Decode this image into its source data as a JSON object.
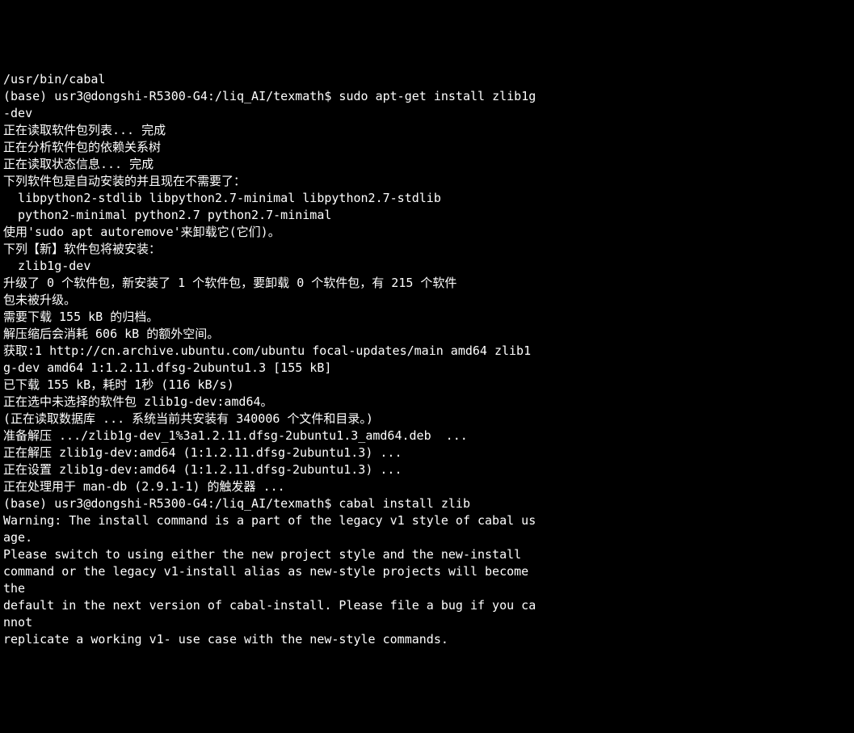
{
  "terminal": {
    "top_partial": "/usr/bin/cabal",
    "prompt1_prefix": "(base) usr3@dongshi-R5300-G4:/liq_AI/texmath$ ",
    "command1": "sudo apt-get install zlib1g",
    "command1_cont": "-dev",
    "output_lines": [
      "正在读取软件包列表... 完成",
      "正在分析软件包的依赖关系树",
      "正在读取状态信息... 完成",
      "下列软件包是自动安装的并且现在不需要了：",
      "  libpython2-stdlib libpython2.7-minimal libpython2.7-stdlib",
      "  python2-minimal python2.7 python2.7-minimal",
      "使用'sudo apt autoremove'来卸载它(它们)。",
      "下列【新】软件包将被安装：",
      "  zlib1g-dev",
      "升级了 0 个软件包，新安装了 1 个软件包，要卸载 0 个软件包，有 215 个软件",
      "包未被升级。",
      "需要下载 155 kB 的归档。",
      "解压缩后会消耗 606 kB 的额外空间。",
      "获取:1 http://cn.archive.ubuntu.com/ubuntu focal-updates/main amd64 zlib1",
      "g-dev amd64 1:1.2.11.dfsg-2ubuntu1.3 [155 kB]",
      "已下载 155 kB，耗时 1秒 (116 kB/s)",
      "正在选中未选择的软件包 zlib1g-dev:amd64。",
      "(正在读取数据库 ... 系统当前共安装有 340006 个文件和目录。)",
      "准备解压 .../zlib1g-dev_1%3a1.2.11.dfsg-2ubuntu1.3_amd64.deb  ...",
      "正在解压 zlib1g-dev:amd64 (1:1.2.11.dfsg-2ubuntu1.3) ...",
      "正在设置 zlib1g-dev:amd64 (1:1.2.11.dfsg-2ubuntu1.3) ...",
      "正在处理用于 man-db (2.9.1-1) 的触发器 ..."
    ],
    "prompt2_prefix": "(base) usr3@dongshi-R5300-G4:/liq_AI/texmath$ ",
    "command2": "cabal install zlib",
    "output2_lines": [
      "Warning: The install command is a part of the legacy v1 style of cabal us",
      "age.",
      "",
      "Please switch to using either the new project style and the new-install",
      "command or the legacy v1-install alias as new-style projects will become",
      "the",
      "default in the next version of cabal-install. Please file a bug if you ca",
      "nnot",
      "replicate a working v1- use case with the new-style commands."
    ]
  }
}
